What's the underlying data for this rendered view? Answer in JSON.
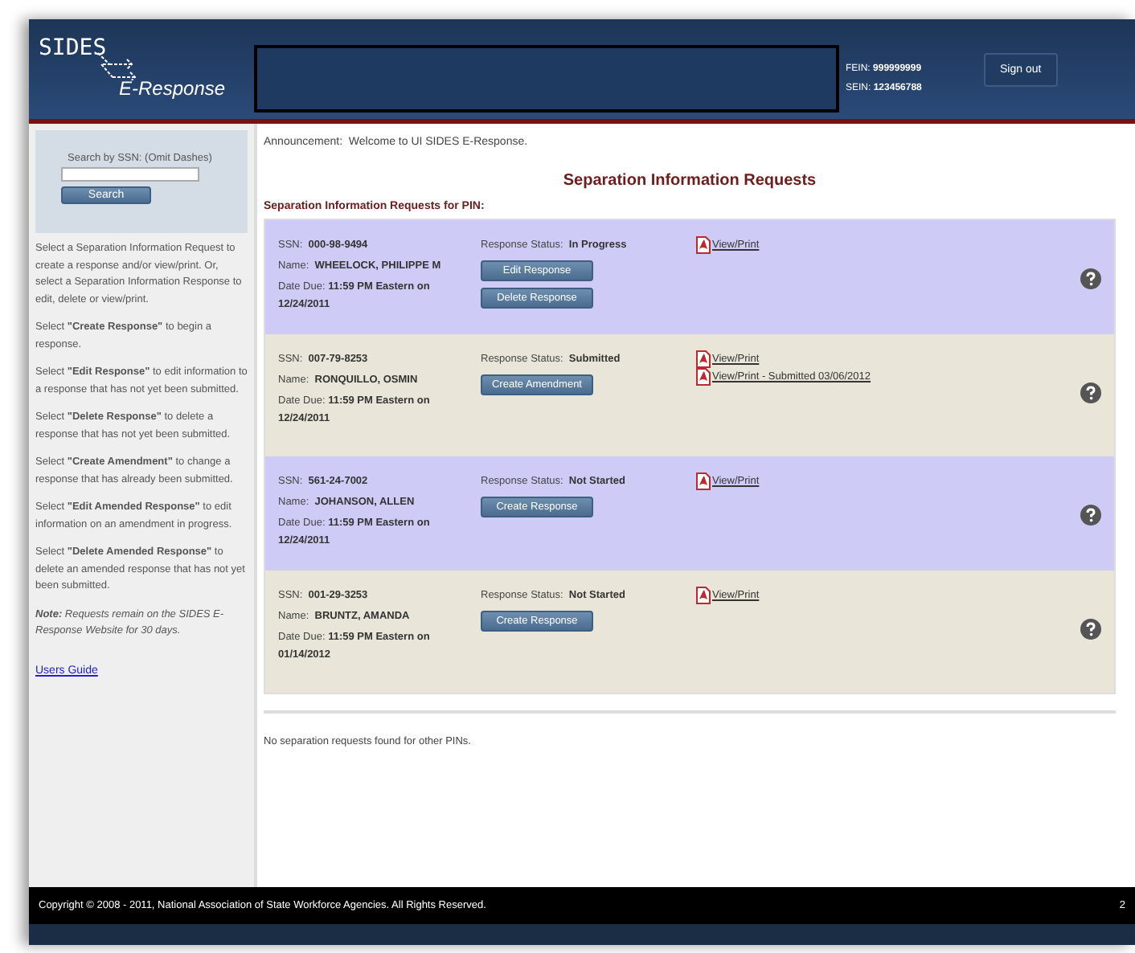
{
  "header": {
    "logo_top": "SIDES",
    "logo_bottom": "E-Response",
    "fein_label": "FEIN:",
    "fein": "999999999",
    "sein_label": "SEIN:",
    "sein": "123456788",
    "sign_out": "Sign out"
  },
  "sidebar": {
    "search_label": "Search by SSN: (Omit Dashes)",
    "search_button": "Search",
    "paragraphs": [
      "Select a Separation Information Request to create a response and/or view/print. Or, select a Separation Information Response to edit, delete or view/print.",
      "Select **\"Create Response\"** to begin a response.",
      "Select **\"Edit Response\"** to edit information to a response that has not yet been submitted.",
      "Select **\"Delete Response\"** to delete a response that has not yet been submitted.",
      "Select **\"Create Amendment\"** to change a response that has already been submitted.",
      "Select **\"Edit Amended Response\"** to edit information on an amendment in progress.",
      "Select **\"Delete Amended Response\"** to delete an amended response that has not yet been submitted."
    ],
    "note": "**Note:** Requests remain on the SIDES E-Response Website for 30 days.",
    "link": "Users Guide"
  },
  "announcement": {
    "label": "Announcement:",
    "text": "Welcome to UI SIDES E-Response."
  },
  "title": "Separation Information Requests",
  "subtitle": "Separation Information Requests for PIN:",
  "requests": [
    {
      "ssn_label": "SSN:",
      "ssn": "000-98-9494",
      "name_label": "Name:",
      "name": "WHEELOCK, PHILIPPE M",
      "due_label": "Date Due:",
      "due": "11:59 PM Eastern on 12/24/2011",
      "status_label": "Response Status:",
      "status": "In Progress",
      "buttons": [
        "Edit Response",
        "Delete Response"
      ],
      "links": [
        "View/Print"
      ]
    },
    {
      "ssn_label": "SSN:",
      "ssn": "007-79-8253",
      "name_label": "Name:",
      "name": "RONQUILLO, OSMIN",
      "due_label": "Date Due:",
      "due": "11:59 PM Eastern on 12/24/2011",
      "status_label": "Response Status:",
      "status": "Submitted",
      "buttons": [
        "Create Amendment"
      ],
      "links": [
        "View/Print",
        "View/Print - Submitted 03/06/2012"
      ]
    },
    {
      "ssn_label": "SSN:",
      "ssn": "561-24-7002",
      "name_label": "Name:",
      "name": "JOHANSON, ALLEN",
      "due_label": "Date Due:",
      "due": "11:59 PM Eastern on 12/24/2011",
      "status_label": "Response Status:",
      "status": "Not Started",
      "buttons": [
        "Create Response"
      ],
      "links": [
        "View/Print"
      ]
    },
    {
      "ssn_label": "SSN:",
      "ssn": "001-29-3253",
      "name_label": "Name:",
      "name": "BRUNTZ, AMANDA",
      "due_label": "Date Due:",
      "due": "11:59 PM Eastern on 01/14/2012",
      "status_label": "Response Status:",
      "status": "Not Started",
      "buttons": [
        "Create Response"
      ],
      "links": [
        "View/Print"
      ]
    }
  ],
  "other_pins": "No separation requests found for other PINs.",
  "footer": {
    "copyright": "Copyright © 2008 - 2011, National Association of State Workforce Agencies. All Rights Reserved.",
    "page": "2"
  }
}
